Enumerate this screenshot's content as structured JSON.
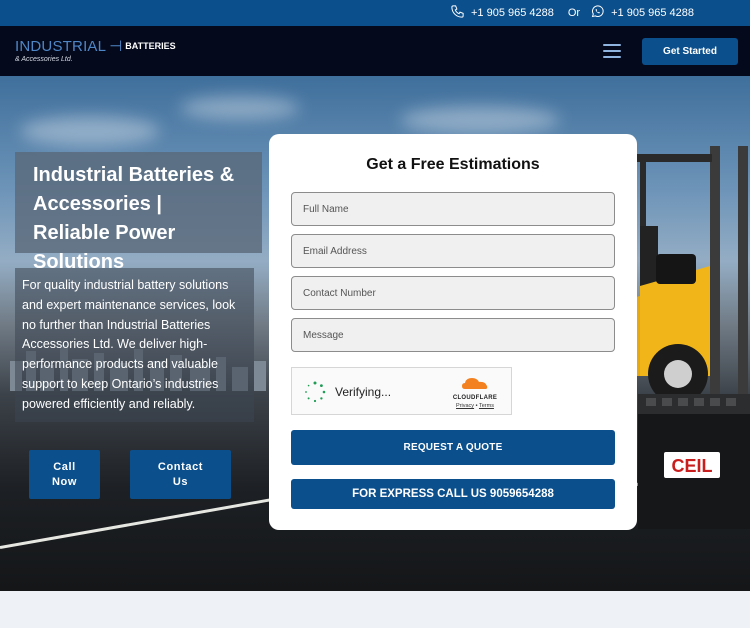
{
  "topbar": {
    "phone_primary": "+1 905 965 4288",
    "separator": "Or",
    "phone_whatsapp": "+1 905 965 4288",
    "icons": [
      "phone-icon",
      "whatsapp-icon"
    ]
  },
  "nav": {
    "logo_main": "INDUSTRIAL",
    "logo_batteries": "BATTERIES",
    "logo_sub": "& Accessories Ltd.",
    "menu_icon": "hamburger-icon",
    "cta_label": "Get Started"
  },
  "hero": {
    "title": "Industrial Batteries & Accessories | Reliable Power Solutions",
    "description": "For quality industrial battery solutions and expert maintenance services, look no further than Industrial Batteries Accessories Ltd. We deliver high-performance products and valuable support to keep Ontario’s industries powered efficiently and reliably.",
    "call_button": "Call Now",
    "contact_button": "Contact Us",
    "battery_brand": "CEIL"
  },
  "form": {
    "title": "Get a Free Estimations",
    "full_name_placeholder": "Full Name",
    "email_placeholder": "Email Address",
    "contact_placeholder": "Contact Number",
    "message_placeholder": "Message",
    "captcha_status": "Verifying...",
    "captcha_provider": "CLOUDFLARE",
    "captcha_privacy": "Privacy",
    "captcha_dot": "•",
    "captcha_terms": "Terms",
    "submit_label": "REQUEST A QUOTE",
    "express_label": "FOR EXPRESS CALL US 9059654288"
  },
  "colors": {
    "brand_blue": "#0b4f8c",
    "nav_dark": "#05091c",
    "accent_yellow": "#f2b519",
    "cloudflare_orange": "#f48120"
  }
}
